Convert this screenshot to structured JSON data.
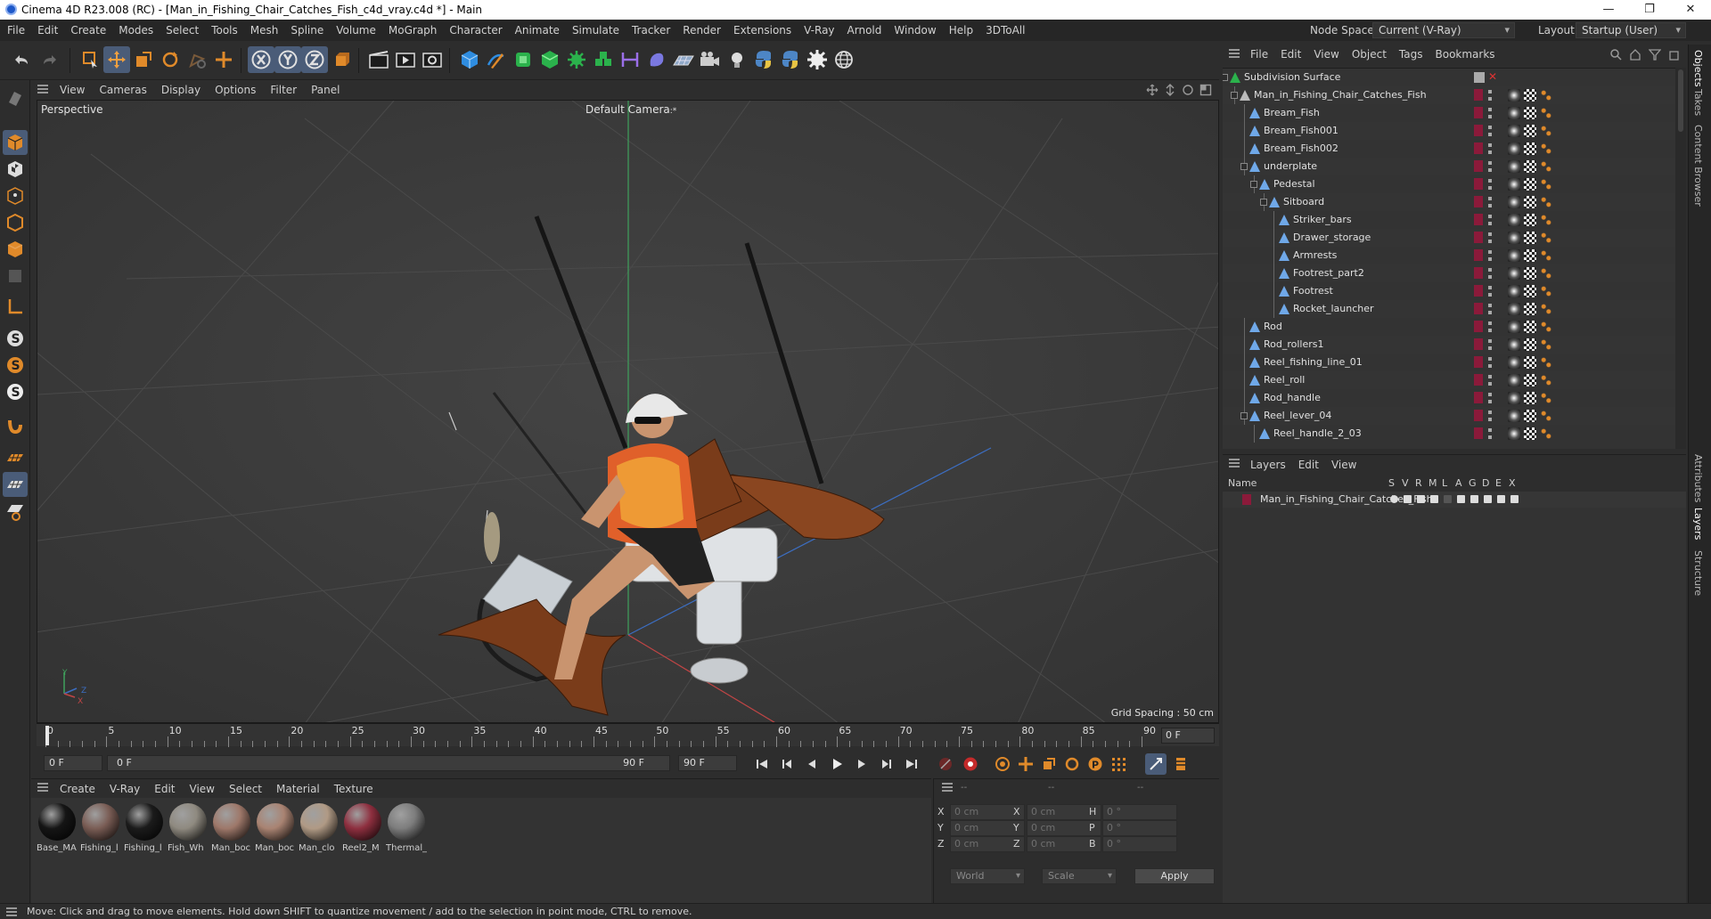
{
  "window": {
    "title": "Cinema 4D R23.008 (RC) - [Man_in_Fishing_Chair_Catches_Fish_c4d_vray.c4d *] - Main",
    "minimize": "—",
    "maximize": "❐",
    "close": "✕"
  },
  "menubar": {
    "items": [
      "File",
      "Edit",
      "Create",
      "Modes",
      "Select",
      "Tools",
      "Mesh",
      "Spline",
      "Volume",
      "MoGraph",
      "Character",
      "Animate",
      "Simulate",
      "Tracker",
      "Render",
      "Extensions",
      "V-Ray",
      "Arnold",
      "Window",
      "Help",
      "3DToAll"
    ],
    "node_space_label": "Node Space:",
    "node_space_value": "Current (V-Ray)",
    "layout_label": "Layout:",
    "layout_value": "Startup (User)"
  },
  "viewport": {
    "menu": [
      "View",
      "Cameras",
      "Display",
      "Options",
      "Filter",
      "Panel"
    ],
    "projection": "Perspective",
    "camera": "Default Camera",
    "camera_suffix": ":*",
    "grid_spacing": "Grid Spacing : 50 cm",
    "axis_y": "Y",
    "axis_z": "Z",
    "axis_x": "X"
  },
  "timeline": {
    "ticks": [
      "0",
      "5",
      "10",
      "15",
      "20",
      "25",
      "30",
      "35",
      "40",
      "45",
      "50",
      "55",
      "60",
      "65",
      "70",
      "75",
      "80",
      "85",
      "90"
    ],
    "current_frame_right": "0 F",
    "start_field": "0 F",
    "range_start": "0 F",
    "range_end": "90 F",
    "end_field": "90 F"
  },
  "materials": {
    "menu": [
      "Create",
      "V-Ray",
      "Edit",
      "View",
      "Select",
      "Material",
      "Texture"
    ],
    "items": [
      {
        "name": "Base_MA",
        "color": "#151515"
      },
      {
        "name": "Fishing_l",
        "color": "#7a5d55"
      },
      {
        "name": "Fishing_l",
        "color": "#1b1b1b"
      },
      {
        "name": "Fish_Wh",
        "color": "#8f8a80"
      },
      {
        "name": "Man_boc",
        "color": "#9e786a"
      },
      {
        "name": "Man_boc",
        "color": "#a98372"
      },
      {
        "name": "Man_clo",
        "color": "#b09a85"
      },
      {
        "name": "Reel2_M",
        "color": "#8e2f3f"
      },
      {
        "name": "Thermal_",
        "color": "#7d7d7d"
      }
    ]
  },
  "coordinates": {
    "header": [
      "--",
      "--",
      "--"
    ],
    "rows": [
      {
        "a": "X",
        "av": "0 cm",
        "b": "X",
        "bv": "0 cm",
        "c": "H",
        "cv": "0 °"
      },
      {
        "a": "Y",
        "av": "0 cm",
        "b": "Y",
        "bv": "0 cm",
        "c": "P",
        "cv": "0 °"
      },
      {
        "a": "Z",
        "av": "0 cm",
        "b": "Z",
        "bv": "0 cm",
        "c": "B",
        "cv": "0 °"
      }
    ],
    "space": "World",
    "mode": "Scale",
    "apply": "Apply"
  },
  "status": {
    "text": "Move: Click and drag to move elements. Hold down SHIFT to quantize movement / add to the selection in point mode, CTRL to remove."
  },
  "objects": {
    "menu": [
      "File",
      "Edit",
      "View",
      "Object",
      "Tags",
      "Bookmarks"
    ],
    "items": [
      {
        "name": "Subdivision Surface",
        "depth": 0,
        "type": "subdiv"
      },
      {
        "name": "Man_in_Fishing_Chair_Catches_Fish",
        "depth": 1,
        "type": "null"
      },
      {
        "name": "Bream_Fish",
        "depth": 2,
        "type": "mesh"
      },
      {
        "name": "Bream_Fish001",
        "depth": 2,
        "type": "mesh"
      },
      {
        "name": "Bream_Fish002",
        "depth": 2,
        "type": "mesh"
      },
      {
        "name": "underplate",
        "depth": 2,
        "type": "mesh"
      },
      {
        "name": "Pedestal",
        "depth": 3,
        "type": "mesh"
      },
      {
        "name": "Sitboard",
        "depth": 4,
        "type": "mesh"
      },
      {
        "name": "Striker_bars",
        "depth": 5,
        "type": "mesh"
      },
      {
        "name": "Drawer_storage",
        "depth": 5,
        "type": "mesh"
      },
      {
        "name": "Armrests",
        "depth": 5,
        "type": "mesh"
      },
      {
        "name": "Footrest_part2",
        "depth": 5,
        "type": "mesh"
      },
      {
        "name": "Footrest",
        "depth": 5,
        "type": "mesh"
      },
      {
        "name": "Rocket_launcher",
        "depth": 5,
        "type": "mesh"
      },
      {
        "name": "Rod",
        "depth": 2,
        "type": "mesh"
      },
      {
        "name": "Rod_rollers1",
        "depth": 2,
        "type": "mesh"
      },
      {
        "name": "Reel_fishing_line_01",
        "depth": 2,
        "type": "mesh"
      },
      {
        "name": "Reel_roll",
        "depth": 2,
        "type": "mesh"
      },
      {
        "name": "Rod_handle",
        "depth": 2,
        "type": "mesh"
      },
      {
        "name": "Reel_lever_04",
        "depth": 2,
        "type": "mesh"
      },
      {
        "name": "Reel_handle_2_03",
        "depth": 3,
        "type": "mesh"
      }
    ]
  },
  "layers": {
    "menu": [
      "Layers",
      "Edit",
      "View"
    ],
    "columns": [
      "Name",
      "S",
      "V",
      "R",
      "M",
      "L",
      "A",
      "G",
      "D",
      "E",
      "X"
    ],
    "items": [
      {
        "name": "Man_in_Fishing_Chair_Catches_Fish",
        "color": "#8b1a3a"
      }
    ]
  },
  "side_tabs": [
    "Objects",
    "Takes",
    "Content Browser",
    "Attributes",
    "Layers",
    "Structure"
  ],
  "colors": {
    "accent": "#4a5c78",
    "layer": "#8b1a3a",
    "axis_x": "#c04545",
    "axis_y": "#3fa15c",
    "axis_z": "#3c6ec2"
  }
}
